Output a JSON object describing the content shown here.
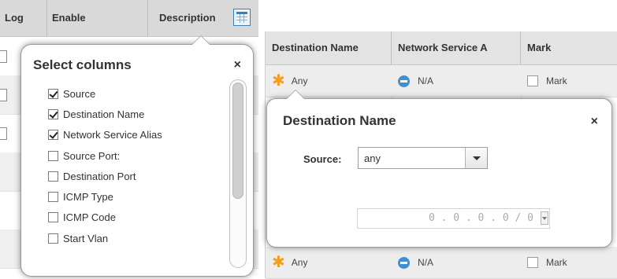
{
  "left_table": {
    "columns": [
      "Log",
      "Enable",
      "Description"
    ]
  },
  "column_chooser_icon": "table-columns-icon",
  "select_columns_popup": {
    "title": "Select columns",
    "close": "×",
    "items": [
      {
        "label": "Source",
        "checked": true
      },
      {
        "label": "Destination Name",
        "checked": true
      },
      {
        "label": "Network Service Alias",
        "checked": true
      },
      {
        "label": "Source Port:",
        "checked": false
      },
      {
        "label": "Destination Port",
        "checked": false
      },
      {
        "label": "ICMP Type",
        "checked": false
      },
      {
        "label": "ICMP Code",
        "checked": false
      },
      {
        "label": "Start Vlan",
        "checked": false
      }
    ]
  },
  "right_table": {
    "columns": [
      "Destination Name",
      "Network Service A",
      "Mark"
    ],
    "rows": [
      {
        "dest": "Any",
        "service": "N/A",
        "mark": "Mark"
      },
      {
        "dest": "Any",
        "service": "N/A",
        "mark": "Mark"
      }
    ]
  },
  "destination_popup": {
    "title": "Destination Name",
    "close": "×",
    "source_label": "Source:",
    "source_value": "any",
    "ip_value": "0 . 0 . 0 . 0 / 0"
  },
  "colors": {
    "header_bg": "#d9d9d9",
    "star": "#f0a020",
    "minus": "#3f8fd2",
    "chooser": "#3a7fb7"
  }
}
